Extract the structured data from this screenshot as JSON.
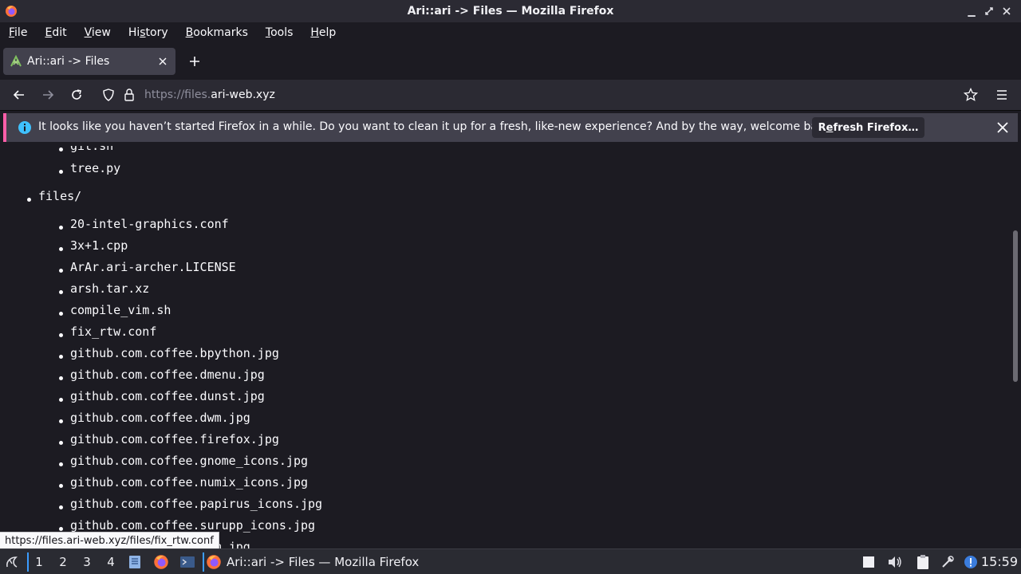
{
  "window": {
    "title": "Ari::ari -> Files — Mozilla Firefox"
  },
  "menu": {
    "items": [
      {
        "pre": "",
        "accel": "F",
        "post": "ile"
      },
      {
        "pre": "",
        "accel": "E",
        "post": "dit"
      },
      {
        "pre": "",
        "accel": "V",
        "post": "iew"
      },
      {
        "pre": "Hi",
        "accel": "s",
        "post": "tory"
      },
      {
        "pre": "",
        "accel": "B",
        "post": "ookmarks"
      },
      {
        "pre": "",
        "accel": "T",
        "post": "ools"
      },
      {
        "pre": "",
        "accel": "H",
        "post": "elp"
      }
    ]
  },
  "tabs": [
    {
      "title": "Ari::ari -> Files"
    }
  ],
  "urlbar": {
    "prefix": "https://files.",
    "host": "ari-web.xyz"
  },
  "notification": {
    "message": "It looks like you haven’t started Firefox in a while. Do you want to clean it up for a fresh, like-new experience? And by the way, welcome back!",
    "button_label_pre": "R",
    "button_label_accel": "e",
    "button_label_post": "fresh Firefox…"
  },
  "listing": {
    "top_items": [
      "git.sh",
      "tree.py"
    ],
    "folder": "files/",
    "files": [
      "20-intel-graphics.conf",
      "3x+1.cpp",
      "ArAr.ari-archer.LICENSE",
      "arsh.tar.xz",
      "compile_vim.sh",
      "fix_rtw.conf",
      "github.com.coffee.bpython.jpg",
      "github.com.coffee.dmenu.jpg",
      "github.com.coffee.dunst.jpg",
      "github.com.coffee.dwm.jpg",
      "github.com.coffee.firefox.jpg",
      "github.com.coffee.gnome_icons.jpg",
      "github.com.coffee.numix_icons.jpg",
      "github.com.coffee.papirus_icons.jpg",
      "github.com.coffee.surupp_icons.jpg",
      "github.com.coffee.vim.jpg"
    ]
  },
  "status_url": "https://files.ari-web.xyz/files/fix_rtw.conf",
  "taskbar": {
    "workspaces": [
      "1",
      "2",
      "3",
      "4"
    ],
    "active_window_title": "Ari::ari -> Files — Mozilla Firefox",
    "clock": "15:59"
  },
  "colors": {
    "accent": "#3b9cff",
    "notification_stripe": "#ff5ea8",
    "info_icon": "#3fc1ff"
  }
}
